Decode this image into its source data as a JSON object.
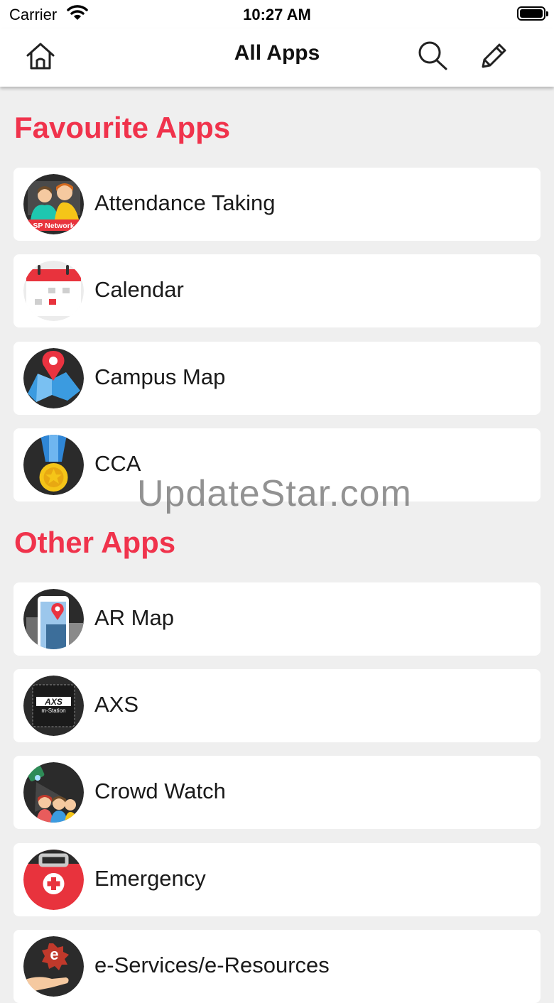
{
  "status_bar": {
    "carrier": "Carrier",
    "time": "10:27 AM"
  },
  "nav": {
    "title": "All Apps"
  },
  "favourites": {
    "title": "Favourite Apps",
    "items": [
      {
        "label": "Attendance Taking",
        "icon": "sp-network-people-icon",
        "badge": "SP Network"
      },
      {
        "label": "Calendar",
        "icon": "calendar-icon"
      },
      {
        "label": "Campus Map",
        "icon": "map-pin-icon"
      },
      {
        "label": "CCA",
        "icon": "medal-icon"
      }
    ]
  },
  "others": {
    "title": "Other Apps",
    "items": [
      {
        "label": "AR Map",
        "icon": "ar-phone-map-icon"
      },
      {
        "label": "AXS",
        "icon": "axs-logo-icon",
        "logo_top": "AXS",
        "logo_bottom": "m-Station"
      },
      {
        "label": "Crowd Watch",
        "icon": "crowd-camera-icon"
      },
      {
        "label": "Emergency",
        "icon": "first-aid-kit-icon"
      },
      {
        "label": "e-Services/e-Resources",
        "icon": "e-services-hand-icon",
        "logo_letter": "e"
      }
    ]
  },
  "watermark": "UpdateStar.com",
  "colors": {
    "accent": "#f0334c",
    "background": "#efefef",
    "card": "#ffffff",
    "icon_dark": "#2b2b2b"
  }
}
